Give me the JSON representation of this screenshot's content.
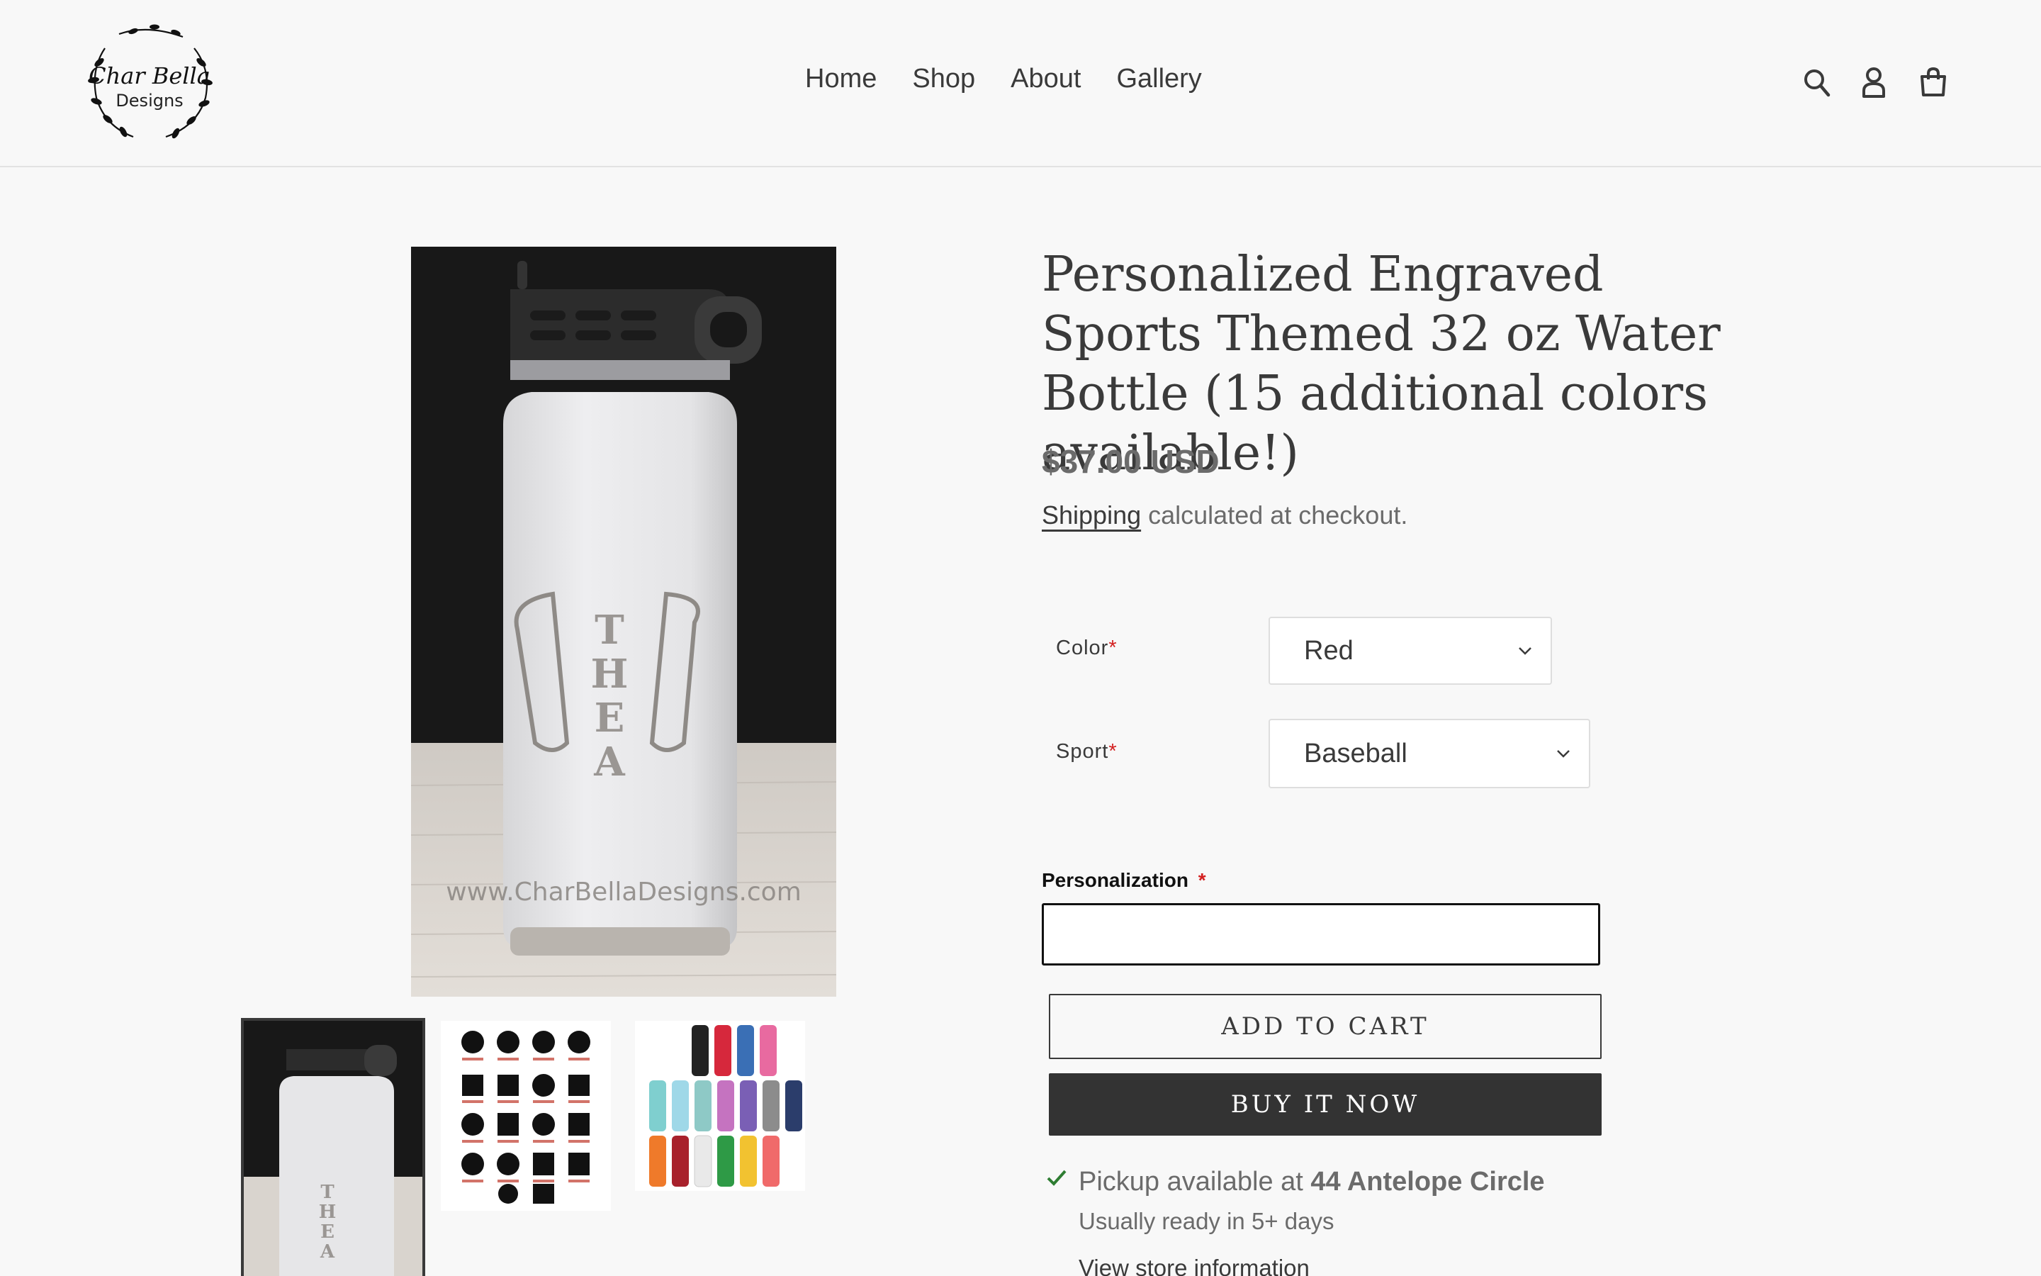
{
  "brand": {
    "line1": "Char Bella",
    "line2": "Designs"
  },
  "nav": [
    "Home",
    "Shop",
    "About",
    "Gallery"
  ],
  "header_icons": [
    "search-icon",
    "account-icon",
    "cart-icon"
  ],
  "gallery": {
    "main_watermark": "www.CharBellaDesigns.com",
    "engraving_name": "THEA",
    "thumbs": [
      "bottle-photo",
      "sports-designs-chart",
      "bottle-colors-chart"
    ]
  },
  "product": {
    "title": "Personalized Engraved Sports Themed 32 oz Water Bottle (15 additional colors available!)",
    "price": "$37.00 USD",
    "shipping_link": "Shipping",
    "shipping_rest": " calculated at checkout."
  },
  "options": {
    "color": {
      "label": "Color",
      "required": "*",
      "value": "Red"
    },
    "sport": {
      "label": "Sport",
      "required": "*",
      "value": "Baseball"
    }
  },
  "personalization": {
    "label": "Personalization",
    "required": "*",
    "value": ""
  },
  "buttons": {
    "add_to_cart": "ADD TO CART",
    "buy_now": "BUY IT NOW"
  },
  "pickup": {
    "prefix": "Pickup available at ",
    "location": "44 Antelope Circle",
    "ready": "Usually ready in 5+ days",
    "store_info": "View store information"
  },
  "colors": {
    "accent": "#333333",
    "required": "#d32020",
    "check": "#2e7d32"
  }
}
